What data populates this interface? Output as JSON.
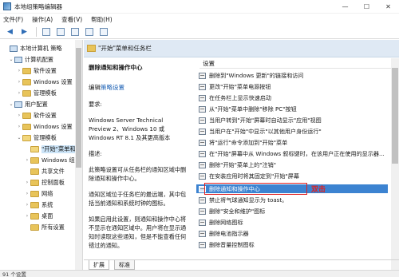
{
  "window": {
    "title": "本地组策略编辑器",
    "controls": {
      "minimize": "—",
      "maximize": "☐",
      "close": "✕"
    }
  },
  "menubar": {
    "items": [
      "文件(F)",
      "操作(A)",
      "查看(V)",
      "帮助(H)"
    ]
  },
  "toolbar": {
    "back": "◀",
    "forward": "▶"
  },
  "tree": {
    "items": [
      {
        "label": "本地计算机 策略",
        "icon": "computer-icon",
        "expander": ""
      },
      {
        "label": "计算机配置",
        "icon": "computer-icon",
        "expander": "⌄"
      },
      {
        "label": "软件设置",
        "icon": "folder-icon",
        "expander": "›"
      },
      {
        "label": "Windows 设置",
        "icon": "folder-icon",
        "expander": "›"
      },
      {
        "label": "管理模板",
        "icon": "folder-icon",
        "expander": "›"
      },
      {
        "label": "用户配置",
        "icon": "computer-icon",
        "expander": "⌄"
      },
      {
        "label": "软件设置",
        "icon": "folder-icon",
        "expander": "›"
      },
      {
        "label": "Windows 设置",
        "icon": "folder-icon",
        "expander": "›"
      },
      {
        "label": "管理模板",
        "icon": "folder-icon",
        "expander": "⌄"
      },
      {
        "label": "\"开始\"菜单和",
        "icon": "folder-open-icon",
        "expander": "",
        "selected": true
      },
      {
        "label": "Windows 组",
        "icon": "folder-icon",
        "expander": "›"
      },
      {
        "label": "共享文件",
        "icon": "folder-icon",
        "expander": ""
      },
      {
        "label": "控制面板",
        "icon": "folder-icon",
        "expander": "›"
      },
      {
        "label": "网络",
        "icon": "folder-icon",
        "expander": "›"
      },
      {
        "label": "系统",
        "icon": "folder-icon",
        "expander": "›"
      },
      {
        "label": "桌面",
        "icon": "folder-icon",
        "expander": "›"
      },
      {
        "label": "所有设置",
        "icon": "folder-icon",
        "expander": ""
      }
    ]
  },
  "header": {
    "title": "\"开始\"菜单和任务栏"
  },
  "description": {
    "policy_title": "删除通知和操作中心",
    "edit_prefix": "编辑",
    "edit_link": "策略设置",
    "requirements_label": "要求:",
    "requirements_text": "Windows Server Technical Preview 2、Windows 10 或 Windows RT 8.1 及其更高版本",
    "desc_label": "描述:",
    "desc_p1": "此策略设置可从任务栏的通知区域中删除通知和操作中心。",
    "desc_p2": "通知区域位于任务栏的最远端，其中包括当前通知和系统时钟的图标。",
    "desc_p3": "如果启用此设置，则通知和操作中心将不显示在通知区域中。用户将在显示通知时读取这些通知，但是不能查看任何错过的通知。"
  },
  "settings": {
    "column_header": "设置",
    "items": [
      "删除到\"Windows 更新\"的链接和访问",
      "更改\"开始\"菜单电源按钮",
      "在任务栏上显示快速启动",
      "从\"开始\"菜单中删除\"移除 PC\"按钮",
      "当用户转到\"开始\"屏幕时自动显示\"应用\"视图",
      "当用户在\"开始\"中显示\"以其他用户身份运行\"",
      "将\"运行\"命令添加到\"开始\"菜单",
      "在\"开始\"屏幕中从 Windows 叙标键时，在该用户正在使用的显示器...",
      "删除\"开始\"菜单上的\"注销\"",
      "在安装应用时将其固定到\"开始\"屏幕",
      "删除通知和操作中心",
      "禁止将气球通知显示为 toast。",
      "删除\"安全和维护\"图标",
      "删除网络图标",
      "删除电池指示器",
      "删除音量控制图标"
    ],
    "selected_index": 10,
    "annotation": "双击"
  },
  "tabs": {
    "items": [
      "扩展",
      "标准"
    ],
    "active_index": 0
  },
  "status": {
    "text": "91 个设置"
  }
}
